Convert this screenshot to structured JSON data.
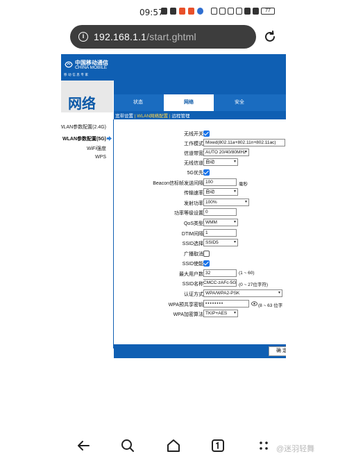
{
  "status_bar": {
    "time": "09:57",
    "battery": "77"
  },
  "browser": {
    "url_host": "192.168.1.1",
    "url_path": "/start.ghtml"
  },
  "banner": {
    "logo_cn": "中国移动通信",
    "logo_en": "CHINA MOBILE",
    "logo_slogan": "移动信息专家"
  },
  "page_title": "网络",
  "tabs": [
    {
      "label": "状态"
    },
    {
      "label": "网络"
    },
    {
      "label": "安全"
    }
  ],
  "subnav": {
    "item1": "宽带设置",
    "sep": "|",
    "item2": "WLAN网络配置",
    "item3": "远程管理"
  },
  "leftnav": {
    "items": [
      {
        "label": "WLAN参数配置(2.4G)"
      },
      {
        "label": "WLAN参数配置(5G)"
      },
      {
        "label": "WiFi强度"
      },
      {
        "label": "WPS"
      }
    ]
  },
  "form": {
    "wireless_switch": {
      "label": "无线开关",
      "checked": true
    },
    "work_mode": {
      "label": "工作模式",
      "value": "Mixed(802.11a+802.11n+802.11ac)"
    },
    "channel_width": {
      "label": "信道带宽",
      "value": "AUTO 20/40/80MHz"
    },
    "wireless_channel": {
      "label": "无线信道",
      "value": "自动"
    },
    "five_g_priority": {
      "label": "5G优先",
      "checked": true
    },
    "beacon_interval": {
      "label": "Beacon信标帧发送间隔",
      "value": "100",
      "unit": "毫秒"
    },
    "tx_rate": {
      "label": "传输速率",
      "value": "自动"
    },
    "tx_power": {
      "label": "发射功率",
      "value": "100%"
    },
    "power_level": {
      "label": "功率等级设置",
      "value": "0"
    },
    "qos_type": {
      "label": "QoS类型",
      "value": "WMM"
    },
    "dtim_interval": {
      "label": "DTIM间隔",
      "value": "1"
    },
    "ssid_select": {
      "label": "SSID选择",
      "value": "SSID5"
    },
    "broadcast_cancel": {
      "label": "广播取消",
      "checked": false
    },
    "ssid_enable": {
      "label": "SSID使能",
      "checked": true
    },
    "max_users": {
      "label": "最大用户数",
      "value": "32",
      "hint": "(1 ~ 60)"
    },
    "ssid_name": {
      "label": "SSID名称",
      "value": "CMCC-zAFc-5G",
      "hint": "(0 ~ 27位字符)"
    },
    "auth_mode": {
      "label": "认证方式",
      "value": "WPA/WPA2-PSK"
    },
    "wpa_key": {
      "label": "WPA预共享密钥",
      "value": "••••••••",
      "hint": "(8 ~ 63 位字"
    },
    "wpa_cipher": {
      "label": "WPA加密算法",
      "value": "TKIP+AES"
    }
  },
  "ok_button": "确 定",
  "watermark": "@迷羽轻舞"
}
